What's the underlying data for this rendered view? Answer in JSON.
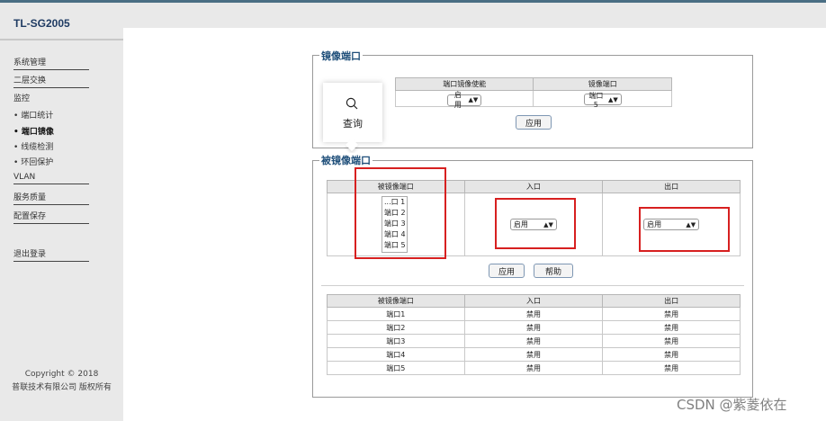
{
  "app": {
    "brand": "TL-SG2005"
  },
  "sidebar": {
    "items": [
      {
        "label": "系统管理"
      },
      {
        "label": "二层交换"
      },
      {
        "label": "监控"
      },
      {
        "label": "VLAN"
      },
      {
        "label": "服务质量"
      },
      {
        "label": "配置保存"
      },
      {
        "label": "退出登录"
      }
    ],
    "sub_items": [
      {
        "label": "端口统计"
      },
      {
        "label": "端口镜像"
      },
      {
        "label": "线缆检测"
      },
      {
        "label": "环回保护"
      }
    ],
    "bullet": "•",
    "copyright_line1": "Copyright © 2018",
    "copyright_line2": "普联技术有限公司 版权所有"
  },
  "mirror_port": {
    "legend": "镜像端口",
    "headers": [
      "端口镜像使能",
      "镜像端口"
    ],
    "enable_value": "启用",
    "port_value": "端口 5",
    "apply_label": "应用"
  },
  "search_popup": {
    "label": "查询",
    "icon": "search-icon"
  },
  "mirrored_ports": {
    "legend": "被镜像端口",
    "headers": [
      "被镜像端口",
      "入口",
      "出口"
    ],
    "list_options": [
      "...口 1",
      "端口 2",
      "端口 3",
      "端口 4",
      "端口 5"
    ],
    "ingress_value": "启用",
    "egress_value": "启用",
    "apply_label": "应用",
    "help_label": "帮助",
    "status_headers": [
      "被镜像端口",
      "入口",
      "出口"
    ],
    "status_rows": [
      {
        "port": "端口1",
        "ingress": "禁用",
        "egress": "禁用"
      },
      {
        "port": "端口2",
        "ingress": "禁用",
        "egress": "禁用"
      },
      {
        "port": "端口3",
        "ingress": "禁用",
        "egress": "禁用"
      },
      {
        "port": "端口4",
        "ingress": "禁用",
        "egress": "禁用"
      },
      {
        "port": "端口5",
        "ingress": "禁用",
        "egress": "禁用"
      }
    ]
  },
  "watermark": "CSDN @紫菱依在",
  "colors": {
    "accent": "#1f4f7a",
    "brand": "#1f3b63",
    "highlight": "#d72020"
  }
}
